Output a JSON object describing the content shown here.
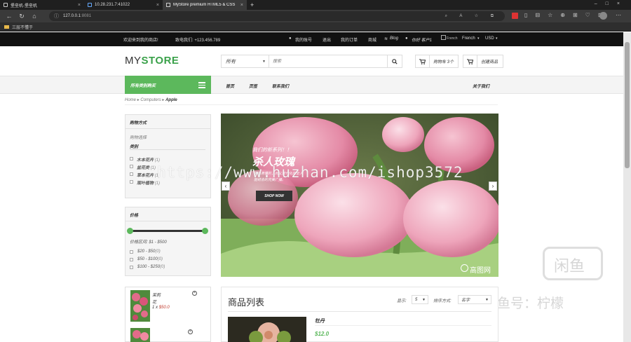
{
  "browser": {
    "tabs": [
      {
        "title": "堡垒机-堡垒机",
        "active": false
      },
      {
        "title": "10.28.231.7:41022",
        "active": false
      },
      {
        "title": "MyStore premium HTML5 & CSS",
        "active": true
      }
    ],
    "new_tab": "+",
    "url_host": "127.0.0.1",
    "url_port": ":8081",
    "bookmark": "三层不懂于"
  },
  "topbar": {
    "welcome": "欢迎来到我的商店!",
    "phone": "致电我们: +123.456.789",
    "my_account": "我的账号",
    "logout": "退出",
    "my_orders": "我的订单",
    "mall": "商城",
    "blog": "Blog",
    "greeting": "你好 客户1",
    "lang_img": "French",
    "lang": "French",
    "currency": "USD"
  },
  "header": {
    "logo_a": "MY",
    "logo_b": "STORE",
    "search_category": "所有",
    "search_placeholder": "搜索",
    "cart_label": "购物车 3个",
    "create_product": "创建商品"
  },
  "menu": {
    "category_button": "所有类别购买",
    "items": [
      "首页",
      "页签",
      "联系我们"
    ],
    "about": "关于我们"
  },
  "breadcrumb": {
    "home": "Home",
    "level1": "Computers",
    "current": "Apple"
  },
  "shopping_panel": {
    "title": "购物方式",
    "subtitle": "购物选择",
    "category_label": "类别",
    "items": [
      {
        "label": "木本花卉",
        "count": "(1)"
      },
      {
        "label": "盆花类",
        "count": "(1)"
      },
      {
        "label": "草本花卉",
        "count": "(1)"
      },
      {
        "label": "观叶植物",
        "count": "(1)"
      }
    ]
  },
  "price_panel": {
    "title": "价格",
    "range_label": "价格区间: $1 - $500",
    "ranges": [
      {
        "label": "$20 - $50",
        "count": "(0)"
      },
      {
        "label": "$50 - $100",
        "count": "(0)"
      },
      {
        "label": "$100 - $250",
        "count": "(0)"
      }
    ]
  },
  "cart_mini": {
    "item_name": "茉莉",
    "item_sub": "花",
    "item_qty_price": "1 x",
    "item_price": "$50.0"
  },
  "slider": {
    "line1": "我们的新系列！！",
    "title": "杀人玫瑰",
    "desc1": "简单易懂的，同义现代化的全人",
    "desc2": "能结合的完美广播。",
    "button": "SHOP NOW",
    "prev": "‹",
    "next": "›",
    "img_brand": "高图网"
  },
  "watermarks": {
    "url": "https://www.huzhan.com/ishop3572",
    "fish": "闲鱼",
    "fish_id": "闲鱼号：柠檬"
  },
  "product_list": {
    "title": "商品列表",
    "show_label": "显示:",
    "show_value": "5",
    "sort_label": "排序方式:",
    "sort_value": "名字",
    "first_product_name": "牡丹",
    "first_product_price": "$12.0"
  },
  "colors": {
    "accent_green": "#5cb85c",
    "price_red": "#c0392b",
    "topbar_bg": "#111111"
  }
}
